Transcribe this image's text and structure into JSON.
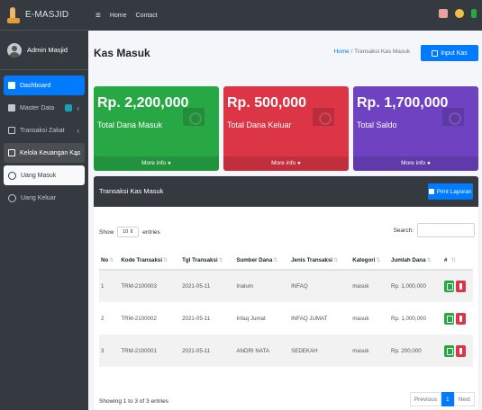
{
  "brand": {
    "name": "E-MASJID"
  },
  "user": {
    "name": "Admin Masjid"
  },
  "sidebar": {
    "items": [
      {
        "label": "Dashboard"
      },
      {
        "label": "Master Data"
      },
      {
        "label": "Transaksi Zakat"
      },
      {
        "label": "Kelola Keuangan Kas"
      },
      {
        "label": "Uang Masuk"
      },
      {
        "label": "Uang Keluar"
      }
    ]
  },
  "topbar": {
    "home": "Home",
    "contact": "Contact"
  },
  "page": {
    "title": "Kas Masuk",
    "breadcrumb_home": "Home",
    "breadcrumb_sep": " / ",
    "breadcrumb_current": "Transaksi Kas Masuk",
    "input_button": "Input Kas"
  },
  "cards": [
    {
      "amount": "Rp. 2,200,000",
      "label": "Total Dana Masuk",
      "more": "More info",
      "color": "#28a745"
    },
    {
      "amount": "Rp. 500,000",
      "label": "Total Dana Keluar",
      "more": "More info",
      "color": "#dc3545"
    },
    {
      "amount": "Rp. 1,700,000",
      "label": "Total Saldo",
      "more": "More info",
      "color": "#6f42c1"
    }
  ],
  "panel": {
    "title": "Transaksi Kas Masuk",
    "print_button": "Print Laporan",
    "show_label": "Show",
    "show_value": "10",
    "entries_label": "entries",
    "search_label": "Search:"
  },
  "table": {
    "headers": [
      "No",
      "Kode Transaksi",
      "Tgl Transaksi",
      "Sumber Dana",
      "Jenis Transaksi",
      "Kategori",
      "Jumlah Dana",
      "#"
    ],
    "rows": [
      [
        "1",
        "TRM-2100003",
        "2021-05-11",
        "Inalum",
        "INFAQ",
        "masuk",
        "Rp. 1,000,000"
      ],
      [
        "2",
        "TRM-2100002",
        "2021-05-11",
        "Infaq Jumat",
        "INFAQ JUMAT",
        "masuk",
        "Rp. 1,000,000"
      ],
      [
        "3",
        "TRM-2100001",
        "2021-05-11",
        "ANDRI NATA",
        "SEDEKAH",
        "masuk",
        "Rp. 200,000"
      ]
    ]
  },
  "footer": {
    "showing": "Showing 1 to 3 of 3 entries",
    "previous": "Previous",
    "page": "1",
    "next": "Next"
  },
  "icons": {
    "hamburger": "menu-icon",
    "print": "printer-icon",
    "input": "plus-square-icon"
  }
}
